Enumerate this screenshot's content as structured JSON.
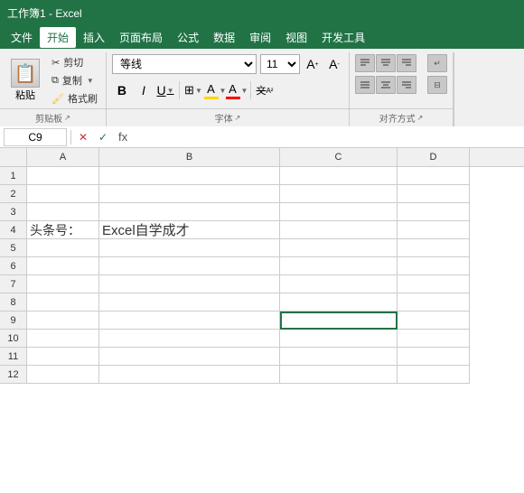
{
  "titleBar": {
    "text": "工作簿1 - Excel"
  },
  "menuBar": {
    "items": [
      {
        "label": "文件",
        "active": false
      },
      {
        "label": "开始",
        "active": true
      },
      {
        "label": "插入",
        "active": false
      },
      {
        "label": "页面布局",
        "active": false
      },
      {
        "label": "公式",
        "active": false
      },
      {
        "label": "数据",
        "active": false
      },
      {
        "label": "审阅",
        "active": false
      },
      {
        "label": "视图",
        "active": false
      },
      {
        "label": "开发工具",
        "active": false
      }
    ]
  },
  "ribbon": {
    "clipboard": {
      "title": "剪贴板",
      "paste": "粘贴",
      "cut": "✂ 剪切",
      "copy": "复制",
      "format_paint": "格式刷"
    },
    "font": {
      "title": "字体",
      "font_name": "等线",
      "font_size": "11",
      "bold": "B",
      "italic": "I",
      "underline": "U",
      "border": "⊞",
      "fill_color": "A",
      "font_color": "A",
      "grow": "A",
      "shrink": "A"
    },
    "alignment": {
      "title": "对齐方式"
    }
  },
  "formulaBar": {
    "cellRef": "C9",
    "cancelLabel": "✕",
    "confirmLabel": "✓",
    "funcLabel": "fx",
    "value": ""
  },
  "columns": [
    "A",
    "B",
    "C",
    "D"
  ],
  "rows": [
    1,
    2,
    3,
    4,
    5,
    6,
    7,
    8,
    9,
    10,
    11,
    12
  ],
  "cellContent": {
    "row4": {
      "colA": "头条号：",
      "colB": "Excel自学成才"
    }
  }
}
